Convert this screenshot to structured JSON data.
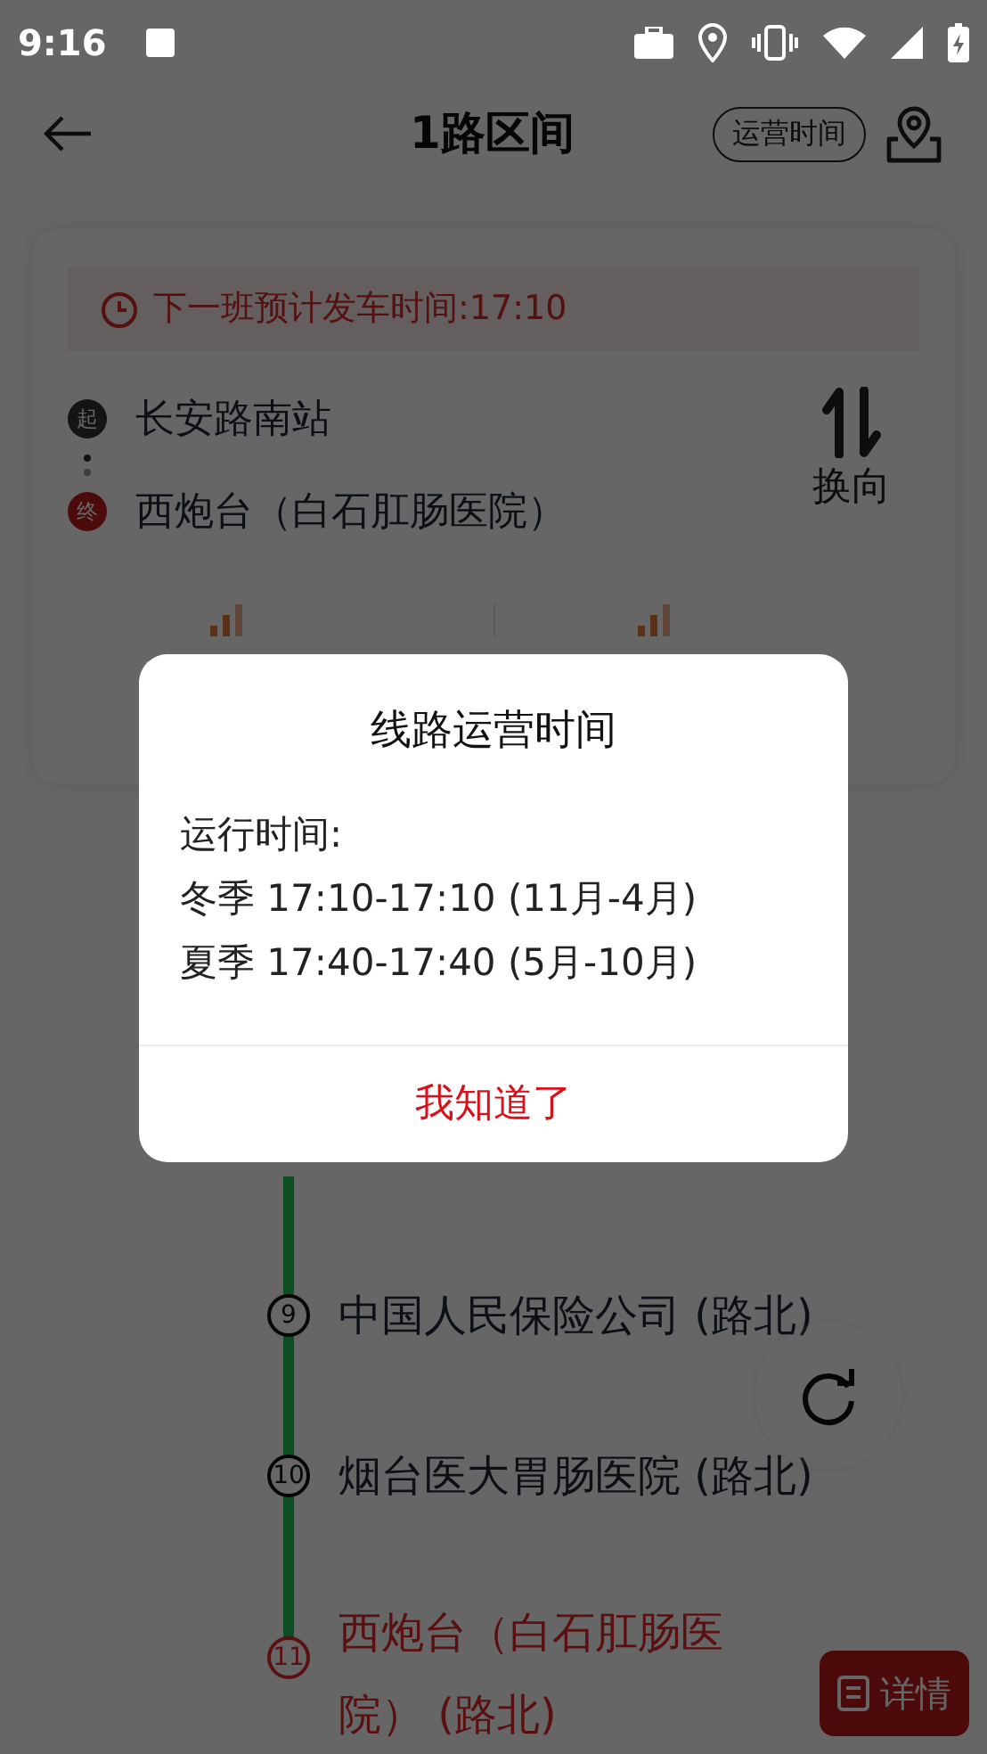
{
  "status_bar": {
    "time": "9:16"
  },
  "header": {
    "title": "1路区间",
    "hours_button": "运营时间"
  },
  "notice": {
    "text": "下一班预计发车时间:17:10"
  },
  "route": {
    "start": {
      "badge": "起",
      "name": "长安路南站"
    },
    "end": {
      "badge": "终",
      "name": "西炮台（白石肛肠医院）"
    },
    "reverse_button": "换向"
  },
  "stations": [
    {
      "number": "9",
      "name": "中国人民保险公司 (路北)",
      "kind": "stop"
    },
    {
      "number": "10",
      "name": "烟台医大胃肠医院 (路北)",
      "kind": "stop"
    },
    {
      "number": "11",
      "name": "西炮台（白石肛肠医院） (路北)",
      "kind": "terminus"
    }
  ],
  "details_button": "详情",
  "dialog": {
    "title": "线路运营时间",
    "lines": [
      "运行时间:",
      "冬季 17:10-17:10 (11月-4月)",
      "夏季 17:40-17:40 (5月-10月)"
    ],
    "button": "我知道了"
  }
}
